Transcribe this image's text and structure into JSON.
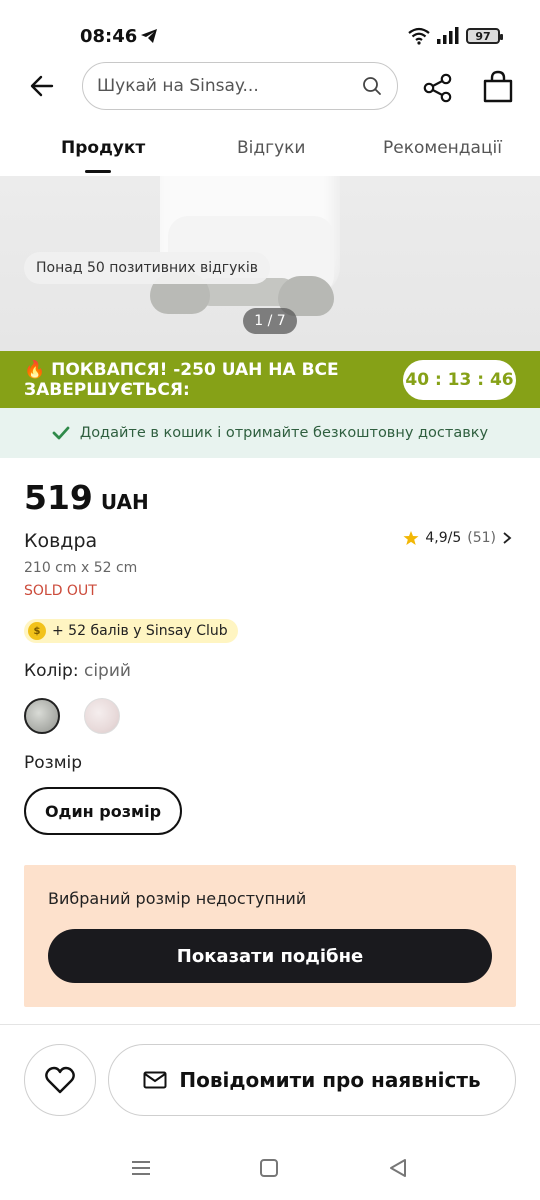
{
  "status_bar": {
    "time": "08:46",
    "battery": "97"
  },
  "search": {
    "placeholder": "Шукай на Sinsay..."
  },
  "tabs": [
    {
      "label": "Продукт",
      "active": true
    },
    {
      "label": "Відгуки",
      "active": false
    },
    {
      "label": "Рекомендації",
      "active": false
    }
  ],
  "gallery": {
    "reviews_badge": "Понад 50 позитивних відгуків",
    "counter": "1 / 7"
  },
  "promo": {
    "text": "🔥 ПОКВАПСЯ! -250 UAH НА ВСЕ ЗАВЕРШУЄТЬСЯ:",
    "timer": "40 : 13 : 46",
    "color": "#86a117"
  },
  "delivery": {
    "text": "Додайте в кошик і отримайте безкоштовну доставку"
  },
  "product": {
    "price": "519",
    "currency": "UAH",
    "name": "Ковдра",
    "rating": "4,9/5",
    "rating_count": "(51)",
    "dimensions": "210 cm x 52 cm",
    "stock_status": "SOLD OUT",
    "club_points": "+ 52 балів у Sinsay Club",
    "color_label": "Колір:",
    "color_value": "сірий",
    "size_label": "Розмір",
    "size_option": "Один розмір"
  },
  "unavailable": {
    "text": "Вибраний розмір недоступний",
    "button": "Показати подібне"
  },
  "bottom_bar": {
    "notify_button": "Повідомити про наявність"
  }
}
